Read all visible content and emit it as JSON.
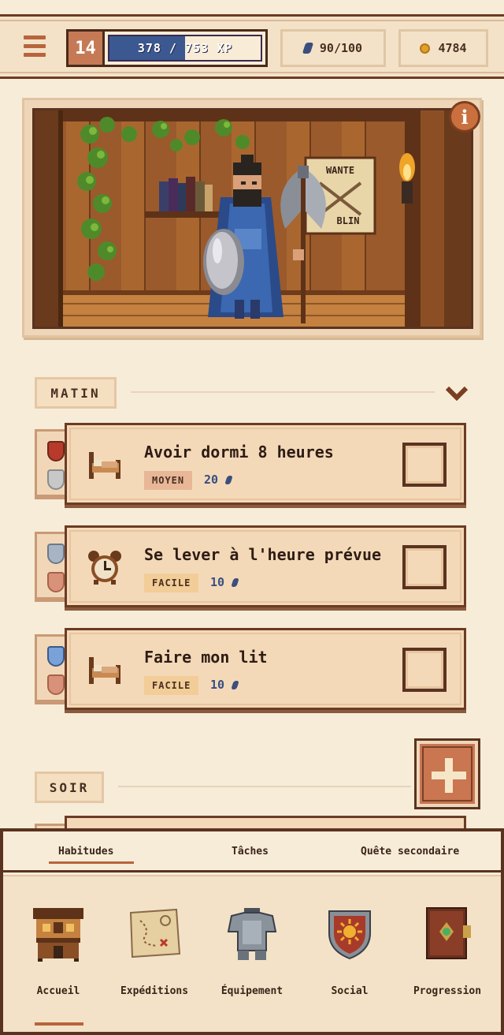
{
  "header": {
    "level": "14",
    "xp_text": "378 / 753 XP",
    "xp_progress": 0.502,
    "gems": "90/100",
    "coins": "4784"
  },
  "scene": {
    "poster_lines": [
      "WANTE",
      "BLIN"
    ]
  },
  "sections": {
    "morning": "MATIN",
    "evening": "SOIR"
  },
  "habits": [
    {
      "title": "Avoir dormi 8 heures",
      "difficulty": "MOYEN",
      "reward": "20",
      "icon": "bed-icon"
    },
    {
      "title": "Se lever à l'heure prévue",
      "difficulty": "FACILE",
      "reward": "10",
      "icon": "alarm-clock-icon"
    },
    {
      "title": "Faire mon lit",
      "difficulty": "FACILE",
      "reward": "10",
      "icon": "bed-icon"
    }
  ],
  "subtabs": [
    "Habitudes",
    "Tâches",
    "Quête secondaire"
  ],
  "nav": [
    "Accueil",
    "Expéditions",
    "Équipement",
    "Social",
    "Progression"
  ],
  "colors": {
    "accent": "#b8643d",
    "gem": "#3b4e7e",
    "coin": "#e0a128",
    "border": "#5a3320"
  }
}
